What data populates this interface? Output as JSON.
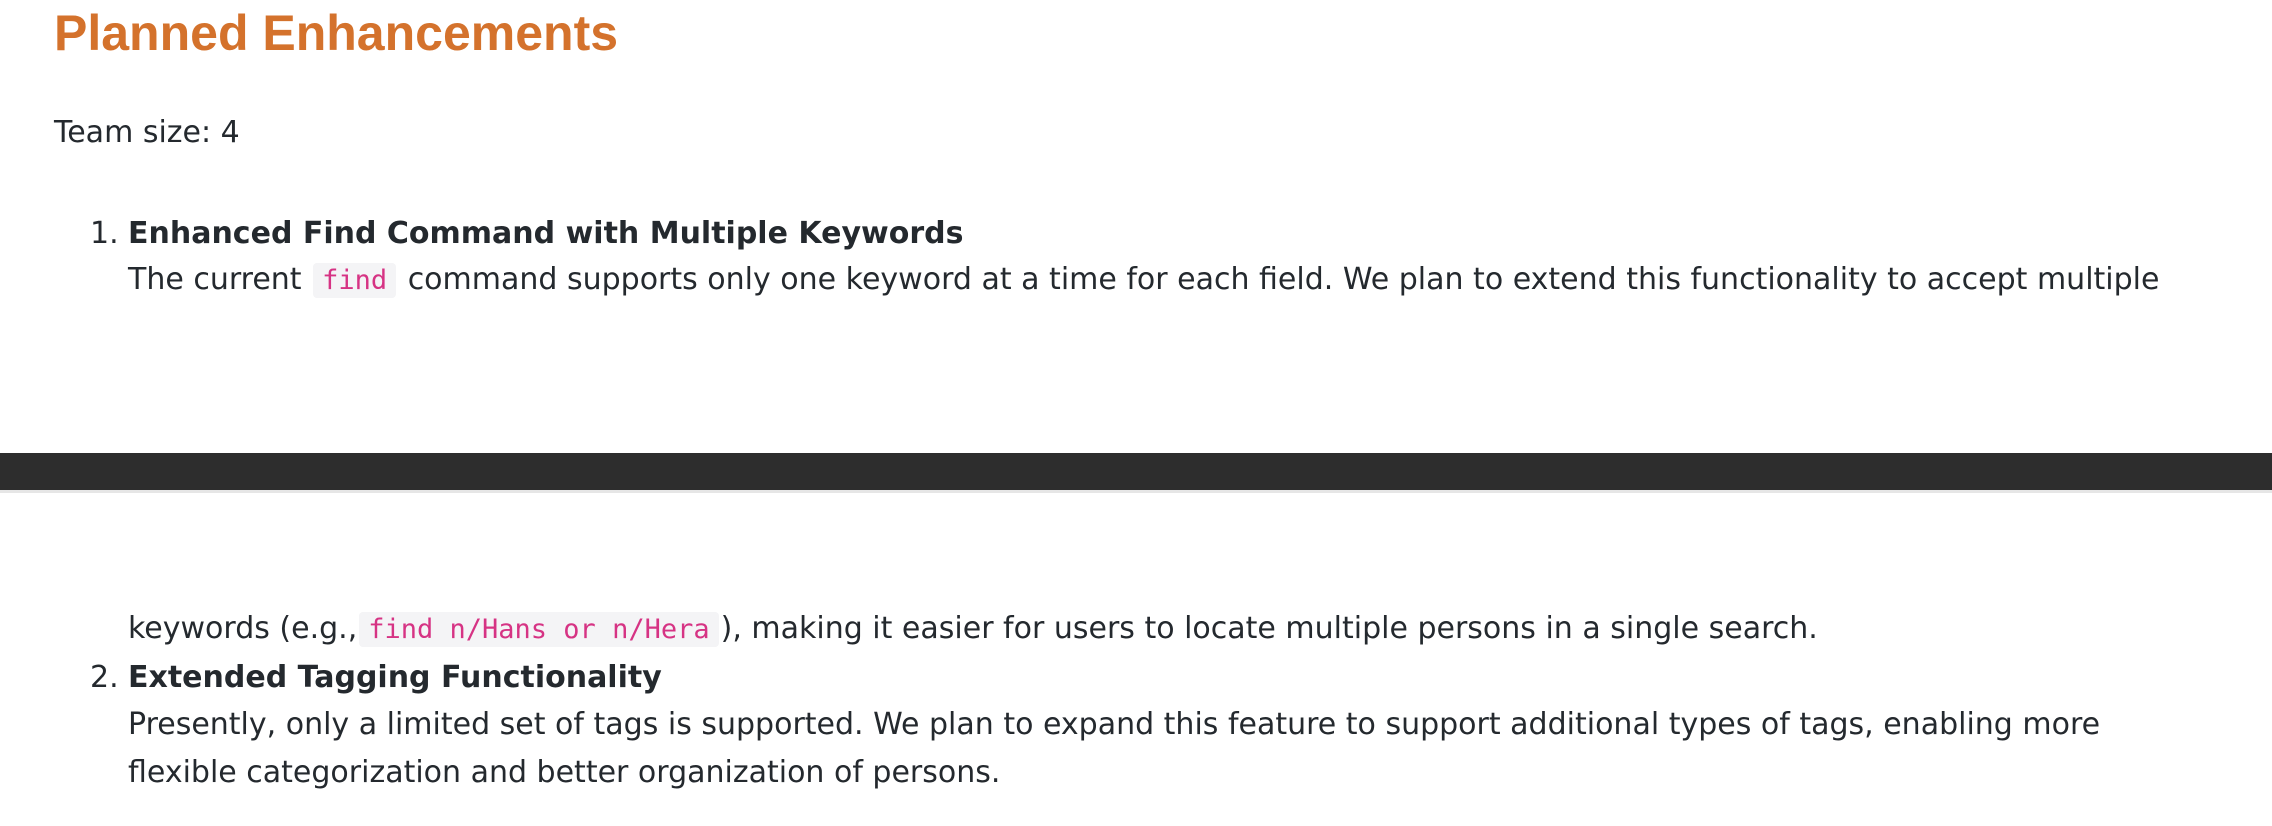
{
  "header": {
    "title": "Planned Enhancements"
  },
  "team": {
    "text": "Team size: 4"
  },
  "items": [
    {
      "number": "1.",
      "title": "Enhanced Find Command with Multiple Keywords",
      "desc_pre": "The current",
      "desc_code": "find",
      "desc_mid": "command supports only one keyword at a time for each field. We plan to extend this functionality to accept multiple",
      "cont_pre": "keywords (e.g.,",
      "cont_code": "find n/Hans or n/Hera",
      "cont_post": "), making it easier for users to locate multiple persons in a single search."
    },
    {
      "number": "2.",
      "title": "Extended Tagging Functionality",
      "desc_line1": "Presently, only a limited set of tags is supported. We plan to expand this feature to support additional types of tags, enabling more",
      "desc_line2": "flexible categorization and better organization of persons."
    }
  ],
  "colors": {
    "heading": "#d4722c",
    "code_text": "#d63384",
    "divider": "#2d2d2d"
  }
}
